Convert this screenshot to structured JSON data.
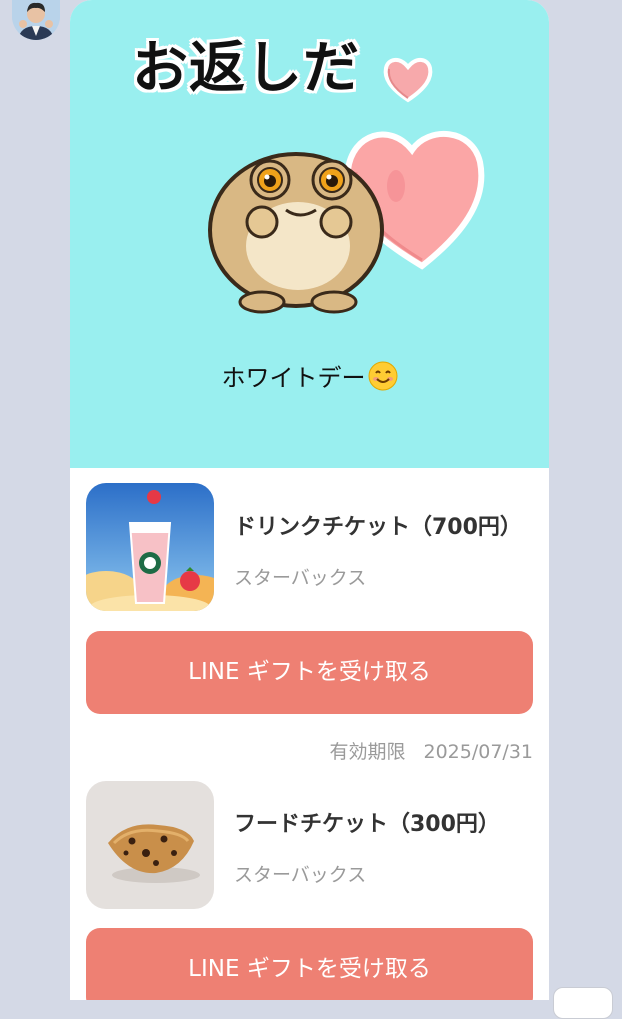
{
  "hero": {
    "title": "お返しだ",
    "message": "ホワイトデー",
    "background": "#99efef"
  },
  "items": [
    {
      "name": "ドリンクチケット（700円）",
      "brand": "スターバックス",
      "button_label": "LINE ギフトを受け取る",
      "expiry_label": "有効期限",
      "expiry_date": "2025/07/31"
    },
    {
      "name": "フードチケット（300円）",
      "brand": "スターバックス",
      "button_label": "LINE ギフトを受け取る"
    }
  ],
  "colors": {
    "chat_background": "#d4d9e6",
    "button": "#ee8073",
    "secondary_text": "#9a9a9a"
  },
  "icons": [
    "avatar",
    "heart-icon",
    "frog-sticker",
    "smile-emoji-icon",
    "drink-thumbnail",
    "scone-thumbnail"
  ]
}
